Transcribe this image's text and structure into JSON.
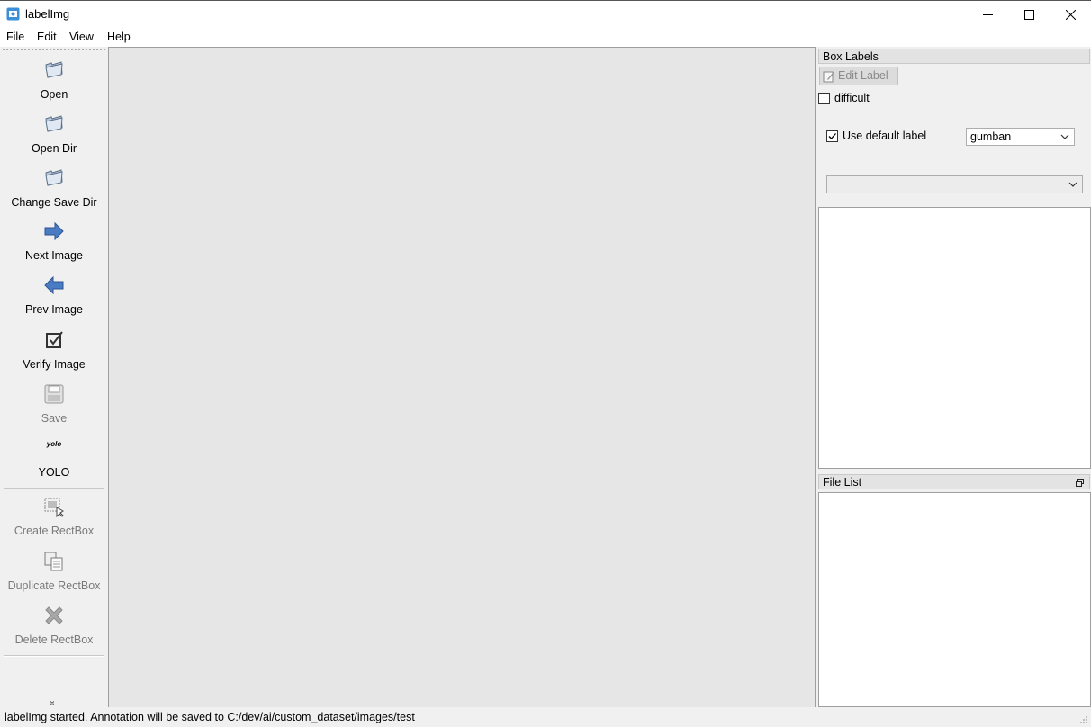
{
  "window": {
    "title": "labelImg",
    "controls": [
      "minimize-icon",
      "maximize-icon",
      "close-icon"
    ]
  },
  "menu": [
    "File",
    "Edit",
    "View",
    "Help"
  ],
  "toolbar": {
    "open": "Open",
    "open_dir": "Open Dir",
    "change_save_dir": "Change Save Dir",
    "next_image": "Next Image",
    "prev_image": "Prev Image",
    "verify_image": "Verify Image",
    "save": "Save",
    "format_icon_text": "yolo",
    "format": "YOLO",
    "create_rectbox": "Create RectBox",
    "duplicate_rectbox": "Duplicate RectBox",
    "delete_rectbox": "Delete RectBox",
    "extension": "»"
  },
  "box_labels": {
    "title": "Box Labels",
    "edit_label": "Edit Label",
    "difficult": "difficult",
    "use_default_label": "Use default label",
    "default_label_value": "gumban",
    "label_filter_value": ""
  },
  "file_list": {
    "title": "File List"
  },
  "status": "labelImg started. Annotation will be saved to C:/dev/ai/custom_dataset/images/test",
  "colors": {
    "canvas": "#e6e6e6",
    "accent_blue": "#4a7cc4"
  }
}
